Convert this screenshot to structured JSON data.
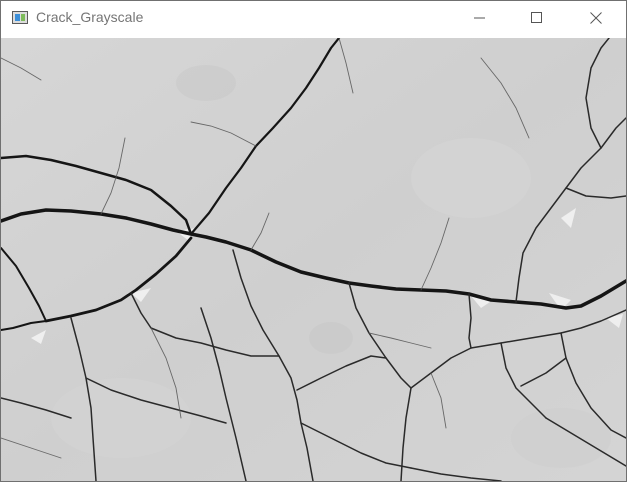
{
  "window": {
    "title": "Crack_Grayscale",
    "app_icon": "opencv-window-icon",
    "controls": {
      "minimize_icon": "minimize-icon",
      "maximize_icon": "maximize-icon",
      "close_icon": "close-icon"
    }
  },
  "image": {
    "subject": "cracked-concrete-grayscale",
    "colors": {
      "surface": "#d2d2d2",
      "crack": "#1e1e1e",
      "highlight": "#f4f4f4"
    }
  }
}
